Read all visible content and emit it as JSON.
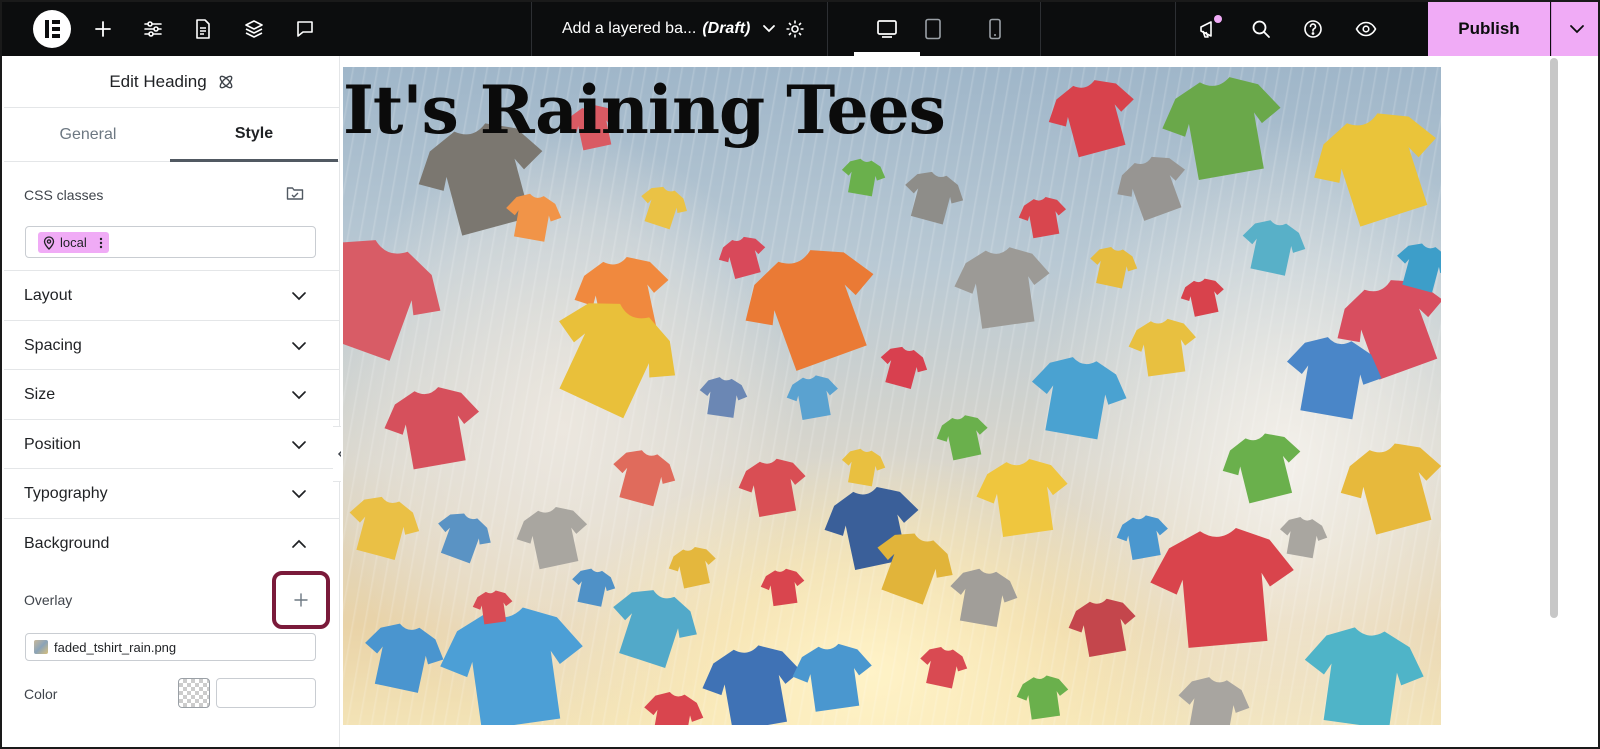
{
  "topbar": {
    "document_title": "Add a layered ba...",
    "document_status": "(Draft)",
    "publish_label": "Publish",
    "active_device": "desktop"
  },
  "panel": {
    "title": "Edit Heading",
    "tabs": [
      {
        "label": "General",
        "active": false
      },
      {
        "label": "Style",
        "active": true
      }
    ],
    "css_classes": {
      "label": "CSS classes",
      "chip_label": "local"
    },
    "sections": [
      {
        "label": "Layout",
        "expanded": false
      },
      {
        "label": "Spacing",
        "expanded": false
      },
      {
        "label": "Size",
        "expanded": false
      },
      {
        "label": "Position",
        "expanded": false
      },
      {
        "label": "Typography",
        "expanded": false
      },
      {
        "label": "Background",
        "expanded": true
      }
    ],
    "background": {
      "overlay_label": "Overlay",
      "overlay_file": "faded_tshirt_rain.png",
      "color_label": "Color",
      "color_value": ""
    }
  },
  "canvas": {
    "heading_text": "It's Raining Tees"
  },
  "colors": {
    "topbar_bg": "#0c0d0e",
    "accent_pink": "#f0abf6",
    "highlight_ring": "#7a1a3a"
  }
}
